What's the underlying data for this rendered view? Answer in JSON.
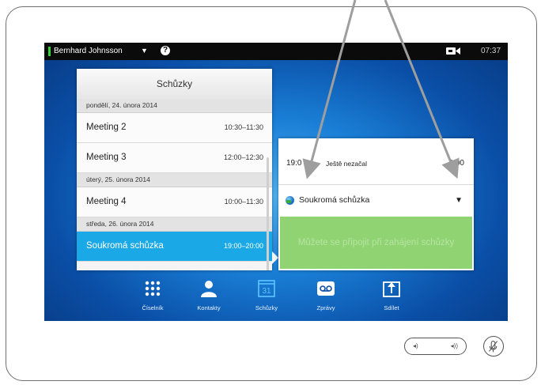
{
  "topbar": {
    "user_name": "Bernhard Johnsson",
    "caret": "▼",
    "help": "?",
    "clock": "07:37",
    "camera_icon": "camera-icon"
  },
  "meetings_panel": {
    "title": "Schůzky",
    "groups": [
      {
        "day": "pondělí, 24. února 2014",
        "items": [
          {
            "name": "Meeting 2",
            "time": "10:30–11:30"
          },
          {
            "name": "Meeting 3",
            "time": "12:00–12:30"
          }
        ]
      },
      {
        "day": "úterý, 25. února 2014",
        "items": [
          {
            "name": "Meeting 4",
            "time": "10:00–11:30"
          }
        ]
      },
      {
        "day": "středa, 26. února 2014",
        "items": [
          {
            "name": "Soukromá schůzka",
            "time": "19:00–20:00",
            "selected": true
          }
        ]
      }
    ]
  },
  "detail": {
    "time_start": "19:0",
    "status": "Ještě nezačal",
    "time_end": "0:00",
    "meeting_name": "Soukromá schůzka",
    "join_text": "Můžete se připojit při zahájení schůzky"
  },
  "dock": [
    {
      "label": "Číselník",
      "icon": "dialpad-icon"
    },
    {
      "label": "Kontakty",
      "icon": "contacts-icon"
    },
    {
      "label": "Schůzky",
      "icon": "calendar-icon",
      "calendar_day": "31"
    },
    {
      "label": "Zprávy",
      "icon": "voicemail-icon"
    },
    {
      "label": "Sdílet",
      "icon": "share-icon"
    }
  ],
  "colors": {
    "accent": "#1aa8e6",
    "join_green": "#8fd373",
    "status_green": "#36d23a"
  }
}
